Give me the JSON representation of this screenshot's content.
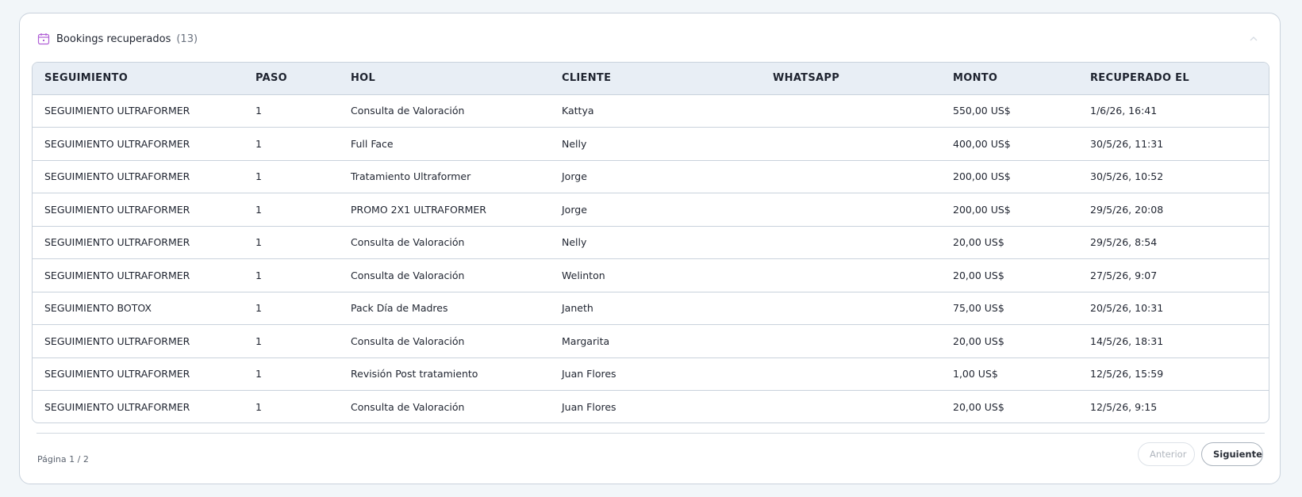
{
  "card": {
    "title": "Bookings recuperados",
    "count": "(13)",
    "icon": "calendar-icon",
    "accent": "#b05fd6"
  },
  "table": {
    "headers": [
      "SEGUIMIENTO",
      "PASO",
      "HOL",
      "CLIENTE",
      "WHATSAPP",
      "MONTO",
      "RECUPERADO EL"
    ],
    "rows": [
      [
        "SEGUIMIENTO ULTRAFORMER",
        "1",
        "Consulta de Valoración",
        "Kattya",
        "",
        "550,00 US$",
        "1/6/26, 16:41"
      ],
      [
        "SEGUIMIENTO ULTRAFORMER",
        "1",
        "Full Face",
        "Nelly",
        "",
        "400,00 US$",
        "30/5/26, 11:31"
      ],
      [
        "SEGUIMIENTO ULTRAFORMER",
        "1",
        "Tratamiento Ultraformer",
        "Jorge",
        "",
        "200,00 US$",
        "30/5/26, 10:52"
      ],
      [
        "SEGUIMIENTO ULTRAFORMER",
        "1",
        "PROMO 2X1 ULTRAFORMER",
        "Jorge",
        "",
        "200,00 US$",
        "29/5/26, 20:08"
      ],
      [
        "SEGUIMIENTO ULTRAFORMER",
        "1",
        "Consulta de Valoración",
        "Nelly",
        "",
        "20,00 US$",
        "29/5/26, 8:54"
      ],
      [
        "SEGUIMIENTO ULTRAFORMER",
        "1",
        "Consulta de Valoración",
        "Welinton",
        "",
        "20,00 US$",
        "27/5/26, 9:07"
      ],
      [
        "SEGUIMIENTO BOTOX",
        "1",
        "Pack Día de Madres",
        "Janeth",
        "",
        "75,00 US$",
        "20/5/26, 10:31"
      ],
      [
        "SEGUIMIENTO ULTRAFORMER",
        "1",
        "Consulta de Valoración",
        "Margarita",
        "",
        "20,00 US$",
        "14/5/26, 18:31"
      ],
      [
        "SEGUIMIENTO ULTRAFORMER",
        "1",
        "Revisión Post tratamiento",
        "Juan Flores",
        "",
        "1,00 US$",
        "12/5/26, 15:59"
      ],
      [
        "SEGUIMIENTO ULTRAFORMER",
        "1",
        "Consulta de Valoración",
        "Juan Flores",
        "",
        "20,00 US$",
        "12/5/26, 9:15"
      ]
    ]
  },
  "pagination": {
    "label": "Página 1 / 2",
    "prev_label": "Anterior",
    "next_label": "Siguiente"
  }
}
